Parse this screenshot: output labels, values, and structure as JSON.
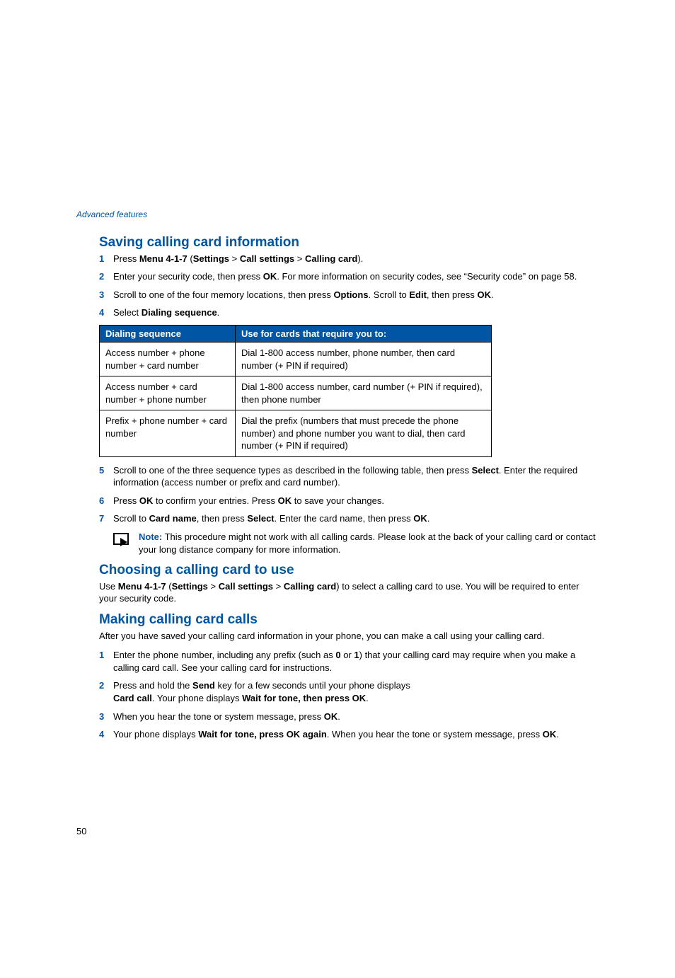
{
  "header": "Advanced features",
  "section1": {
    "title": "Saving calling card information",
    "items": [
      {
        "num": "1",
        "pre": "Press ",
        "bold1": "Menu 4-1-7",
        "mid1": " (",
        "bold2": "Settings",
        "mid2": " > ",
        "bold3": "Call settings",
        "mid3": " > ",
        "bold4": "Calling card",
        "post": ")."
      },
      {
        "num": "2",
        "pre": "Enter your security code, then press ",
        "bold1": "OK",
        "post": ". For more information on security codes, see “Security code” on page 58."
      },
      {
        "num": "3",
        "pre": "Scroll to one of the four memory locations, then press ",
        "bold1": "Options",
        "mid1": ". Scroll to ",
        "bold2": "Edit",
        "mid2": ", then press ",
        "bold3": "OK",
        "post": "."
      },
      {
        "num": "4",
        "pre": "Select ",
        "bold1": "Dialing sequence",
        "post": "."
      }
    ],
    "table": {
      "headers": [
        "Dialing sequence",
        "Use for cards that require you to:"
      ],
      "rows": [
        [
          "Access number + phone number + card number",
          "Dial 1-800 access number, phone number, then card number (+ PIN if required)"
        ],
        [
          "Access number + card number + phone number",
          "Dial 1-800 access number, card number (+ PIN if required), then phone number"
        ],
        [
          "Prefix + phone number + card number",
          "Dial the prefix (numbers that must precede the phone number) and phone number you want to dial, then card number (+ PIN if required)"
        ]
      ]
    },
    "items2": [
      {
        "num": "5",
        "pre": "Scroll to one of the three sequence types as described in the following table, then press ",
        "bold1": "Select",
        "post": ". Enter the required information (access number or prefix and card number)."
      },
      {
        "num": "6",
        "pre": "Press ",
        "bold1": "OK",
        "mid1": " to confirm your entries. Press ",
        "bold2": "OK",
        "post": " to save your changes."
      },
      {
        "num": "7",
        "pre": "Scroll to ",
        "bold1": "Card name",
        "mid1": ", then press ",
        "bold2": "Select",
        "mid2": ". Enter the card name, then press ",
        "bold3": "OK",
        "post": "."
      }
    ],
    "note_label": "Note:",
    "note_text": " This procedure might not work with all calling cards. Please look at the back of your calling card or contact your long distance company for more information."
  },
  "section2": {
    "title": "Choosing a calling card to use",
    "pre": "Use ",
    "bold1": "Menu 4-1-7",
    "mid1": " (",
    "bold2": "Settings",
    "mid2": " > ",
    "bold3": "Call settings",
    "mid3": " > ",
    "bold4": "Calling card",
    "post": ") to select a calling card to use. You will be required to enter your security code."
  },
  "section3": {
    "title": "Making calling card calls",
    "para": "After you have saved your calling card information in your phone, you can make a call using your calling card.",
    "items": [
      {
        "num": "1",
        "pre": "Enter the phone number, including any prefix (such as ",
        "bold1": "0",
        "mid1": " or ",
        "bold2": "1",
        "post": ") that your calling card may require when you make a calling card call. See your calling card for instructions."
      },
      {
        "num": "2",
        "pre": "Press and hold the ",
        "bold1": "Send",
        "mid1": " key for a few seconds until your phone displays ",
        "line2_bold": "Card call",
        "line2_mid": ". Your phone displays ",
        "line2_bold2": "Wait for tone, then press OK",
        "post": "."
      },
      {
        "num": "3",
        "pre": "When you hear the tone or system message, press ",
        "bold1": "OK",
        "post": "."
      },
      {
        "num": "4",
        "pre": "Your phone displays ",
        "bold1": "Wait for tone, press OK again",
        "mid1": ". When you hear the tone or system message, press ",
        "bold2": "OK",
        "post": "."
      }
    ]
  },
  "page_number": "50"
}
